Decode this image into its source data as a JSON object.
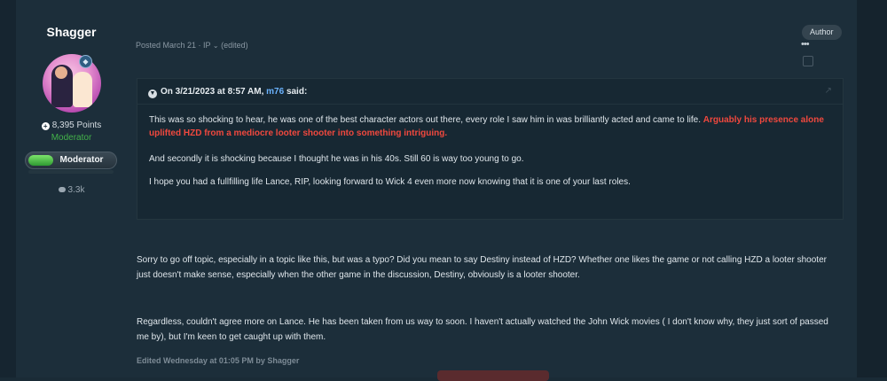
{
  "author": {
    "name": "Shagger",
    "points": "8,395 Points",
    "role": "Moderator",
    "badge_label": "Moderator",
    "message_count": "3.3k"
  },
  "post": {
    "meta": "Posted March 21 · IP",
    "meta_edited": "(edited)",
    "author_tag": "Author",
    "more": "•••"
  },
  "quote": {
    "prefix": "On 3/21/2023 at 8:57 AM,",
    "user": "m76",
    "suffix": "said:",
    "p1_normal": "This was so shocking to hear, he was one of the best character actors out there, every role I saw him in was brilliantly acted and came to life.",
    "p1_red": "Arguably his presence alone uplifted HZD from a mediocre looter shooter into something intriguing.",
    "p2": "And secondly it is shocking because I thought he was in his 40s. Still 60 is way too young to go.",
    "p3": "I hope you had a fullfilling life Lance, RIP, looking forward to Wick 4 even more now knowing that it is one of your last roles."
  },
  "body": {
    "p1": "Sorry to go off topic, especially in a topic like this, but was a typo? Did you mean to say Destiny instead of HZD? Whether one likes the game or not calling HZD a looter shooter just doesn't make sense, especially when the other game in the discussion, Destiny, obviously is a looter shooter.",
    "p2": "Regardless, couldn't agree more on Lance. He has been taken from us way to soon. I haven't actually watched the John Wick movies ( I don't know why, they just sort of passed me by), but I'm keen to get caught up with them."
  },
  "edited_note": "Edited Wednesday at 01:05 PM by Shagger",
  "colors": {
    "background": "#1c2e3a",
    "moderator_green": "#43b34a",
    "highlight_red": "#f0483e",
    "mention_blue": "#6bb3ff"
  }
}
